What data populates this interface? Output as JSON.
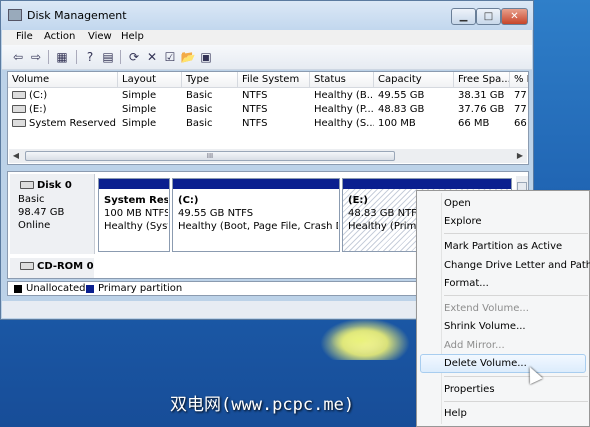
{
  "window": {
    "title": "Disk Management"
  },
  "menubar": [
    "File",
    "Action",
    "View",
    "Help"
  ],
  "toolbar_icons": [
    "back-arrow-icon",
    "forward-arrow-icon",
    "console-tree-icon",
    "help-icon",
    "properties-icon",
    "refresh-icon",
    "delete-icon",
    "check-icon",
    "open-folder-icon",
    "settings-icon"
  ],
  "volumes": {
    "columns": [
      "Volume",
      "Layout",
      "Type",
      "File System",
      "Status",
      "Capacity",
      "Free Spa...",
      "% F"
    ],
    "rows": [
      [
        "(C:)",
        "Simple",
        "Basic",
        "NTFS",
        "Healthy (B...",
        "49.55 GB",
        "38.31 GB",
        "77"
      ],
      [
        "(E:)",
        "Simple",
        "Basic",
        "NTFS",
        "Healthy (P...",
        "48.83 GB",
        "37.76 GB",
        "77"
      ],
      [
        "System Reserved",
        "Simple",
        "Basic",
        "NTFS",
        "Healthy (S...",
        "100 MB",
        "66 MB",
        "66"
      ]
    ],
    "scroll_thumb": "III"
  },
  "disk0": {
    "name": "Disk 0",
    "type": "Basic",
    "size": "98.47 GB",
    "status": "Online",
    "partitions": [
      {
        "name": "System Rese",
        "size": "100 MB NTFS",
        "status": "Healthy (Syste"
      },
      {
        "name": "(C:)",
        "size": "49.55 GB NTFS",
        "status": "Healthy (Boot, Page File, Crash Dum"
      },
      {
        "name": "(E:)",
        "size": "48.83 GB NTFS",
        "status": "Healthy (Primar"
      }
    ]
  },
  "cdrom": {
    "name": "CD-ROM 0"
  },
  "legend": {
    "unallocated": "Unallocated",
    "primary": "Primary partition"
  },
  "context_menu": {
    "items": [
      {
        "label": "Open",
        "enabled": true
      },
      {
        "label": "Explore",
        "enabled": true
      },
      {
        "label": "Mark Partition as Active",
        "enabled": true
      },
      {
        "label": "Change Drive Letter and Paths...",
        "enabled": true
      },
      {
        "label": "Format...",
        "enabled": true
      },
      {
        "label": "Extend Volume...",
        "enabled": false
      },
      {
        "label": "Shrink Volume...",
        "enabled": true
      },
      {
        "label": "Add Mirror...",
        "enabled": false
      },
      {
        "label": "Delete Volume...",
        "enabled": true
      },
      {
        "label": "Properties",
        "enabled": true
      },
      {
        "label": "Help",
        "enabled": true
      }
    ],
    "highlighted": "Delete Volume..."
  },
  "watermark": "双电网(www.pcpc.me)",
  "colors": {
    "primary_partition": "#0a1f8f",
    "unallocated": "#000000"
  }
}
